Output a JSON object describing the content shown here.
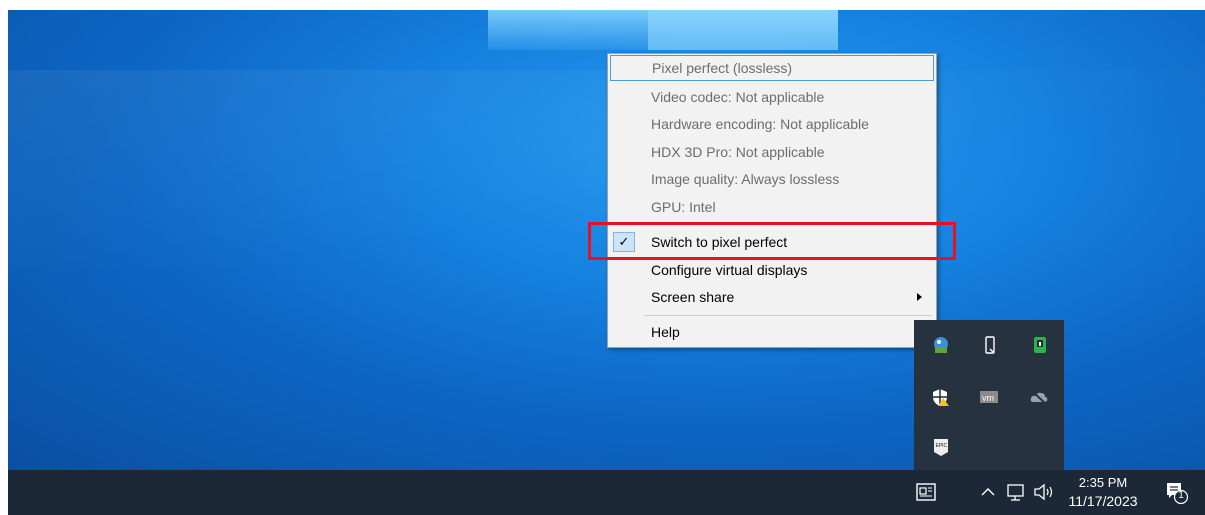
{
  "menu": {
    "items": [
      {
        "label": "Pixel perfect (lossless)"
      },
      {
        "label": "Video codec: Not applicable"
      },
      {
        "label": "Hardware encoding: Not applicable"
      },
      {
        "label": "HDX 3D Pro: Not applicable"
      },
      {
        "label": "Image quality: Always lossless"
      },
      {
        "label": "GPU: Intel"
      },
      {
        "label": "Switch to pixel perfect",
        "checked": true
      },
      {
        "label": "Configure virtual displays"
      },
      {
        "label": "Screen share",
        "submenu": true
      },
      {
        "label": "Help"
      }
    ],
    "check_glyph": "✓"
  },
  "tray_icons": [
    "network-icon",
    "usb-drive-icon",
    "battery-app-icon",
    "windows-security-warning-icon",
    "vmware-icon",
    "cloud-offline-icon",
    "epic-games-icon"
  ],
  "vmware_text": "vm",
  "epic_text": "EPIC",
  "taskbar": {
    "time": "2:35 PM",
    "date": "11/17/2023",
    "notification_count": "1"
  },
  "colors": {
    "highlight_box": "#e81123",
    "taskbar": "#1c2837"
  }
}
